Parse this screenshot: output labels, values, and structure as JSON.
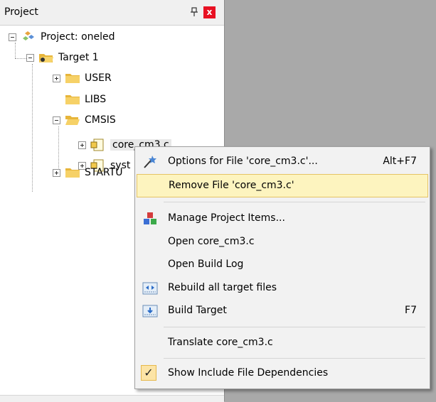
{
  "panel": {
    "title": "Project",
    "close_label": "x"
  },
  "tree": {
    "project": "Project: oneled",
    "target": "Target 1",
    "user": "USER",
    "libs": "LIBS",
    "cmsis": "CMSIS",
    "file1": "core_cm3.c",
    "file2": "syst",
    "startup": "STARTU"
  },
  "menu": {
    "options": {
      "label": "Options for File 'core_cm3.c'...",
      "shortcut": "Alt+F7"
    },
    "remove": {
      "label": "Remove File 'core_cm3.c'"
    },
    "manage": {
      "label": "Manage Project Items..."
    },
    "open": {
      "label": "Open core_cm3.c"
    },
    "build_log": {
      "label": "Open Build Log"
    },
    "rebuild": {
      "label": "Rebuild all target files"
    },
    "build_target": {
      "label": "Build Target",
      "shortcut": "F7"
    },
    "translate": {
      "label": "Translate core_cm3.c"
    },
    "show_deps": {
      "label": "Show Include File Dependencies",
      "check": "✓"
    }
  },
  "colors": {
    "highlight_bg": "#fdf4bf",
    "highlight_border": "#e5c365",
    "folder": "#f2c94c",
    "close_button": "#e81123"
  }
}
